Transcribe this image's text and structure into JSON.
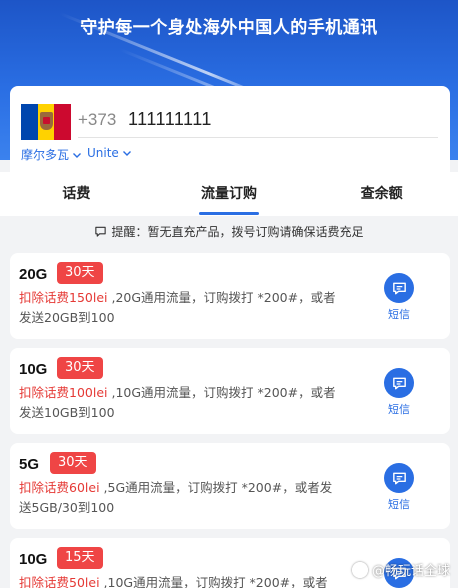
{
  "header": {
    "title": "守护每一个身处海外中国人的手机通讯"
  },
  "phone": {
    "country_code": "+373",
    "number": "111111111",
    "country": "摩尔多瓦",
    "operator": "Unite",
    "flag_colors": [
      "#0046ae",
      "#ffd200",
      "#cc092f"
    ]
  },
  "tabs": [
    {
      "label": "话费",
      "active": false
    },
    {
      "label": "流量订购",
      "active": true
    },
    {
      "label": "查余额",
      "active": false
    }
  ],
  "notice": {
    "text": "提醒：暂无直充产品，拨号订购请确保话费充足"
  },
  "packages": [
    {
      "size": "20G",
      "days": "30天",
      "fee": "扣除话费150lei",
      "desc_line1": " ,20G通用流量，订购拨打 *200#，或者",
      "desc_line2": "发送20GB到100",
      "action": "短信"
    },
    {
      "size": "10G",
      "days": "30天",
      "fee": "扣除话费100lei",
      "desc_line1": " ,10G通用流量，订购拨打 *200#，或者",
      "desc_line2": "发送10GB到100",
      "action": "短信"
    },
    {
      "size": "5G",
      "days": "30天",
      "fee": "扣除话费60lei",
      "desc_line1": " ,5G通用流量，订购拨打 *200#，或者发",
      "desc_line2": "送5GB/30到100",
      "action": "短信"
    },
    {
      "size": "10G",
      "days": "15天",
      "fee": "扣除话费50lei",
      "desc_line1": " ,10G通用流量，订购拨打 *200#，或者",
      "desc_line2": "",
      "action": "短信"
    }
  ],
  "watermark": {
    "text": "@畅玩话全球"
  },
  "colors": {
    "accent": "#2a6ee3",
    "badge": "#ef4545",
    "fee_text": "#e53935"
  }
}
